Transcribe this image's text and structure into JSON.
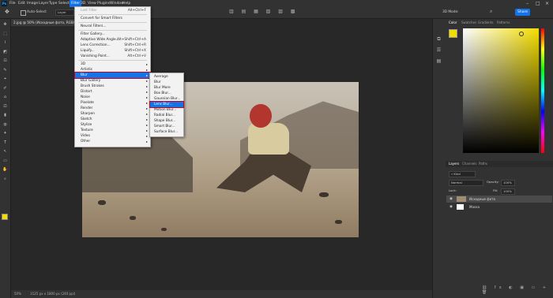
{
  "menubar": {
    "logo": "Ps",
    "items": [
      "File",
      "Edit",
      "Image",
      "Layer",
      "Type",
      "Select",
      "Filter",
      "3D",
      "View",
      "Plugins",
      "Window",
      "Help"
    ],
    "active_index": 6
  },
  "optionsbar": {
    "auto_select": "Auto-Select",
    "target": "Layer",
    "share": "Share",
    "mode_3d": "3D Mode:"
  },
  "document_tab": "2.jpg @ 50% (Исходные фото, RGB/8#) ×",
  "status": {
    "zoom": "50%",
    "size": "3125 px x 1800 px (240 ppi)"
  },
  "filter_menu": {
    "items": [
      {
        "label": "Last Filter",
        "shortcut": "Alt+Ctrl+F",
        "disabled": true
      },
      {
        "sep": true
      },
      {
        "label": "Convert for Smart Filters"
      },
      {
        "sep": true
      },
      {
        "label": "Neural Filters..."
      },
      {
        "sep": true
      },
      {
        "label": "Filter Gallery..."
      },
      {
        "label": "Adaptive Wide Angle...",
        "shortcut": "Alt+Shift+Ctrl+A"
      },
      {
        "label": "Lens Correction...",
        "shortcut": "Shift+Ctrl+R"
      },
      {
        "label": "Liquify...",
        "shortcut": "Shift+Ctrl+X"
      },
      {
        "label": "Vanishing Point...",
        "shortcut": "Alt+Ctrl+V"
      },
      {
        "sep": true
      },
      {
        "label": "3D",
        "submenu": true
      },
      {
        "label": "Artistic",
        "submenu": true
      },
      {
        "label": "Blur",
        "submenu": true,
        "highlighted": true
      },
      {
        "label": "Blur Gallery",
        "submenu": true
      },
      {
        "label": "Brush Strokes",
        "submenu": true
      },
      {
        "label": "Distort",
        "submenu": true
      },
      {
        "label": "Noise",
        "submenu": true
      },
      {
        "label": "Pixelate",
        "submenu": true
      },
      {
        "label": "Render",
        "submenu": true
      },
      {
        "label": "Sharpen",
        "submenu": true
      },
      {
        "label": "Sketch",
        "submenu": true
      },
      {
        "label": "Stylize",
        "submenu": true
      },
      {
        "label": "Texture",
        "submenu": true
      },
      {
        "label": "Video",
        "submenu": true
      },
      {
        "label": "Other",
        "submenu": true
      }
    ]
  },
  "blur_submenu": {
    "items": [
      {
        "label": "Average"
      },
      {
        "label": "Blur"
      },
      {
        "label": "Blur More"
      },
      {
        "label": "Box Blur..."
      },
      {
        "label": "Gaussian Blur..."
      },
      {
        "label": "Lens Blur...",
        "highlighted": true
      },
      {
        "label": "Motion Blur..."
      },
      {
        "label": "Radial Blur..."
      },
      {
        "label": "Shape Blur..."
      },
      {
        "label": "Smart Blur..."
      },
      {
        "label": "Surface Blur..."
      }
    ]
  },
  "color_panel": {
    "tabs": [
      "Color",
      "Swatches",
      "Gradients",
      "Patterns"
    ],
    "foreground": "#f4de00"
  },
  "layers_panel": {
    "tabs": [
      "Layers",
      "Channels",
      "Paths"
    ],
    "kind": "Kind",
    "blend_mode": "Normal",
    "opacity_label": "Opacity:",
    "opacity": "100%",
    "lock_label": "Lock:",
    "fill_label": "Fill:",
    "fill": "100%",
    "layers": [
      {
        "name": "Исходные фото",
        "selected": true
      },
      {
        "name": "Маска",
        "selected": false
      }
    ]
  },
  "colors": {
    "accent": "#1473e6",
    "highlight_outline": "#d0021b",
    "panel": "#323232",
    "background": "#282828"
  }
}
